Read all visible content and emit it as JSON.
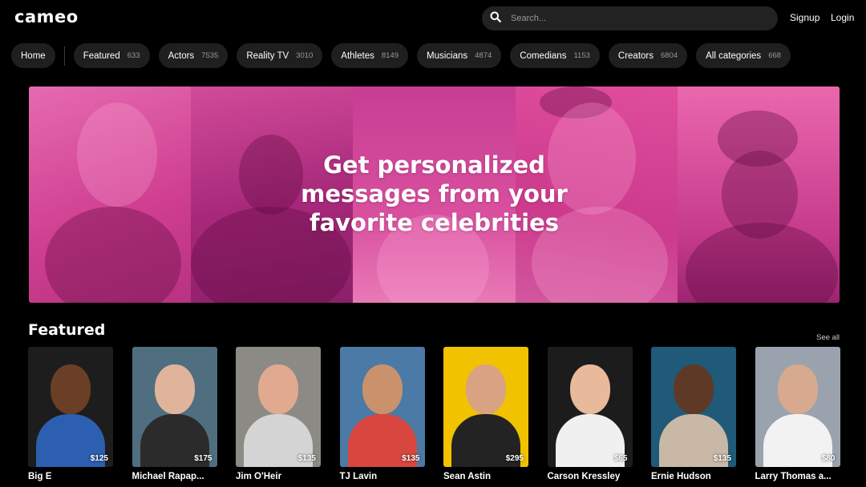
{
  "header": {
    "logo": "cameo",
    "search_placeholder": "Search...",
    "signup": "Signup",
    "login": "Login"
  },
  "categories": [
    {
      "label": "Home",
      "count": ""
    },
    {
      "label": "Featured",
      "count": "633"
    },
    {
      "label": "Actors",
      "count": "7535"
    },
    {
      "label": "Reality TV",
      "count": "3010"
    },
    {
      "label": "Athletes",
      "count": "8149"
    },
    {
      "label": "Musicians",
      "count": "4874"
    },
    {
      "label": "Comedians",
      "count": "1153"
    },
    {
      "label": "Creators",
      "count": "6804"
    },
    {
      "label": "All categories",
      "count": "668"
    }
  ],
  "hero": {
    "line1": "Get personalized",
    "line2": "messages from your",
    "line3": "favorite celebrities"
  },
  "featured": {
    "title": "Featured",
    "see_all": "See all",
    "items": [
      {
        "name": "Big E",
        "price": "$125",
        "bg": "#1d1d1d",
        "skin": "#6b3f26",
        "shirt": "#2c5fb0"
      },
      {
        "name": "Michael Rapap...",
        "price": "$175",
        "bg": "#4f6e7f",
        "skin": "#e0b49a",
        "shirt": "#2b2b2b"
      },
      {
        "name": "Jim O'Heir",
        "price": "$135",
        "bg": "#8c8a85",
        "skin": "#e1a98f",
        "shirt": "#d4d4d4"
      },
      {
        "name": "TJ Lavin",
        "price": "$135",
        "bg": "#4a7aa5",
        "skin": "#c9926d",
        "shirt": "#d8473f"
      },
      {
        "name": "Sean Astin",
        "price": "$295",
        "bg": "#f1c200",
        "skin": "#d8a283",
        "shirt": "#232323"
      },
      {
        "name": "Carson Kressley",
        "price": "$65",
        "bg": "#1c1c1c",
        "skin": "#e8b99b",
        "shirt": "#f0f0f0"
      },
      {
        "name": "Ernie Hudson",
        "price": "$135",
        "bg": "#1f5a78",
        "skin": "#5e3a26",
        "shirt": "#c9b8a5"
      },
      {
        "name": "Larry Thomas a...",
        "price": "$80",
        "bg": "#9aa3ad",
        "skin": "#d7a98f",
        "shirt": "#f2f2f2"
      }
    ]
  }
}
